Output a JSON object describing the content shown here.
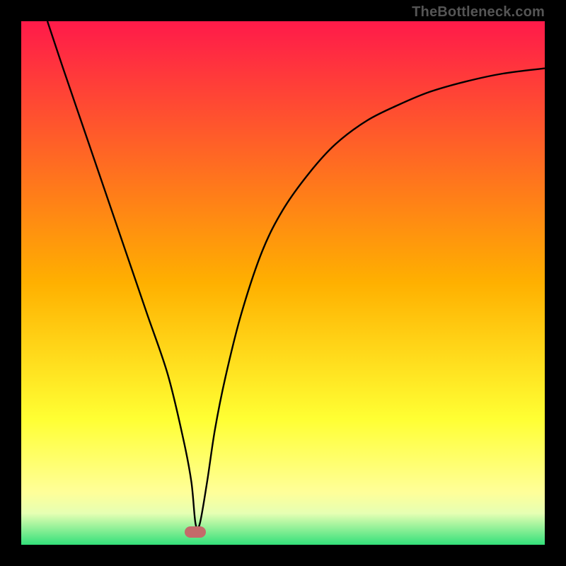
{
  "attribution": "TheBottleneck.com",
  "chart_data": {
    "type": "line",
    "title": "",
    "xlabel": "",
    "ylabel": "",
    "xlim": [
      0,
      100
    ],
    "ylim": [
      0,
      100
    ],
    "grid": false,
    "legend": false,
    "background_gradient": {
      "stops": [
        {
          "pos": 0.0,
          "color": "#ff1a4a"
        },
        {
          "pos": 0.5,
          "color": "#ffb000"
        },
        {
          "pos": 0.76,
          "color": "#ffff33"
        },
        {
          "pos": 0.9,
          "color": "#ffff99"
        },
        {
          "pos": 0.94,
          "color": "#e6ffb3"
        },
        {
          "pos": 1.0,
          "color": "#33e07a"
        }
      ]
    },
    "series": [
      {
        "name": "bottleneck-curve",
        "x": [
          5,
          8,
          12,
          16,
          20,
          24,
          28,
          31,
          32.5,
          33.3,
          34.1,
          35.5,
          37,
          39,
          42,
          46,
          50,
          55,
          60,
          66,
          72,
          78,
          85,
          92,
          100
        ],
        "y": [
          100,
          91,
          79.3,
          67.6,
          55.9,
          44.2,
          32.5,
          20,
          12,
          4,
          4,
          12,
          22,
          32,
          44,
          56,
          64,
          71,
          76.5,
          81,
          84,
          86.5,
          88.5,
          90,
          91
        ]
      }
    ],
    "marker": {
      "x": 33.3,
      "y": 2.5,
      "color": "#c46a6a"
    }
  }
}
